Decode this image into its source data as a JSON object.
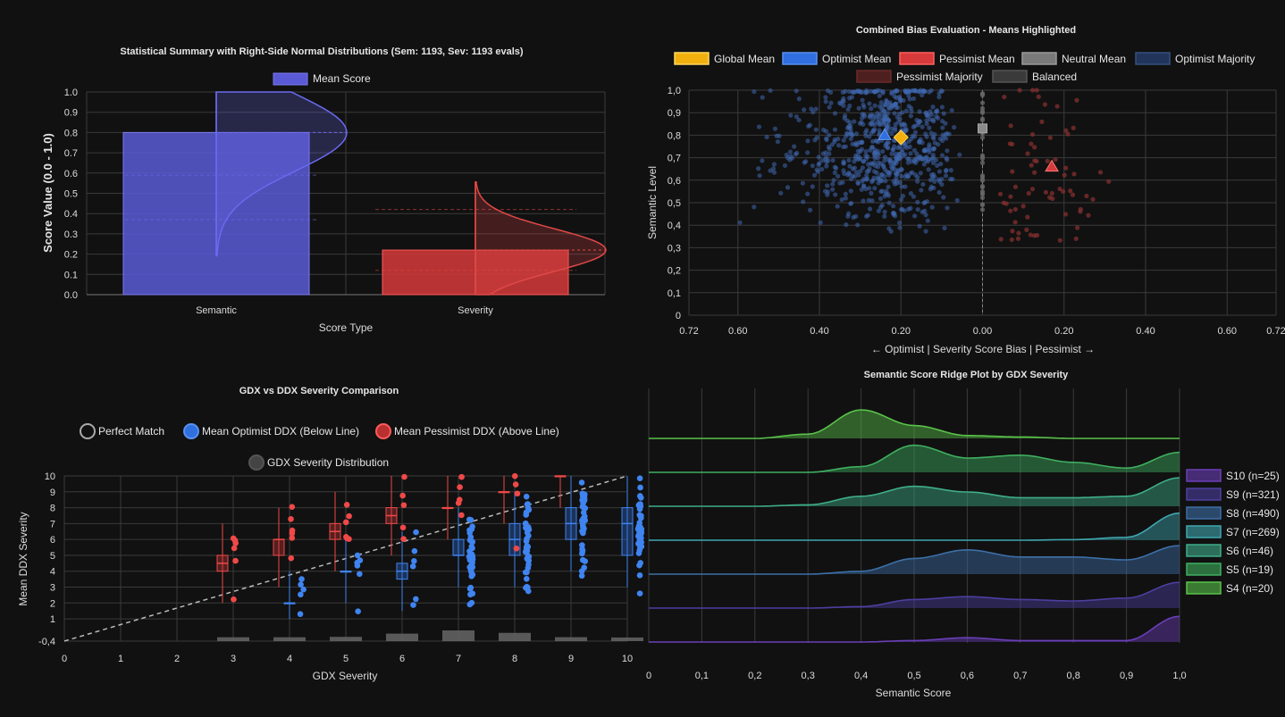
{
  "panel1": {
    "title": "Statistical Summary with Right-Side Normal Distributions (Sem: 1193, Sev: 1193 evals)",
    "legend": "Mean Score",
    "ylabel": "Score Value (0.0 - 1.0)",
    "xlabel": "Score Type",
    "yticks": [
      "0.0",
      "0.1",
      "0.2",
      "0.3",
      "0.4",
      "0.5",
      "0.6",
      "0.7",
      "0.8",
      "0.9",
      "1.0"
    ]
  },
  "panel2": {
    "title": "Combined Bias Evaluation - Means Highlighted",
    "legend": [
      "Global Mean",
      "Optimist Mean",
      "Pessimist Mean",
      "Neutral Mean",
      "Optimist Majority",
      "Pessimist Majority",
      "Balanced"
    ],
    "ylabel": "Semantic Level",
    "xlabel": "← Optimist | Severity Score Bias | Pessimist →",
    "yticks": [
      "0",
      "0,1",
      "0,2",
      "0,3",
      "0,4",
      "0,5",
      "0,6",
      "0,7",
      "0,8",
      "0,9",
      "1,0"
    ],
    "xticks": [
      "0.72",
      "0.60",
      "0.40",
      "0.20",
      "0.00",
      "0.20",
      "0.40",
      "0.60",
      "0.72"
    ]
  },
  "panel3": {
    "title": "GDX vs DDX Severity Comparison",
    "legend": [
      "Perfect Match",
      "Mean Optimist DDX (Below Line)",
      "Mean Pessimist DDX (Above Line)",
      "GDX Severity Distribution"
    ],
    "ylabel": "Mean DDX Severity",
    "xlabel": "GDX Severity",
    "yticks": [
      "-0,4",
      "1",
      "2",
      "3",
      "4",
      "5",
      "6",
      "7",
      "8",
      "9",
      "10"
    ],
    "xticks": [
      "0",
      "1",
      "2",
      "3",
      "4",
      "5",
      "6",
      "7",
      "8",
      "9",
      "10"
    ]
  },
  "panel4": {
    "title": "Semantic Score Ridge Plot by GDX Severity",
    "xlabel": "Semantic Score",
    "xticks": [
      "0",
      "0,1",
      "0,2",
      "0,3",
      "0,4",
      "0,5",
      "0,6",
      "0,7",
      "0,8",
      "0,9",
      "1,0"
    ],
    "legend": [
      "S10 (n=25)",
      "S9 (n=321)",
      "S8 (n=490)",
      "S7 (n=269)",
      "S6 (n=46)",
      "S5 (n=19)",
      "S4 (n=20)"
    ]
  },
  "chart_data": [
    {
      "type": "bar",
      "title": "Statistical Summary with Right-Side Normal Distributions (Sem: 1193, Sev: 1193 evals)",
      "categories": [
        "Semantic",
        "Severity"
      ],
      "series": [
        {
          "name": "Mean Score",
          "values": [
            0.8,
            0.22
          ]
        }
      ],
      "colors": [
        "#5a5ad6",
        "#d63a3a"
      ],
      "xlabel": "Score Type",
      "ylabel": "Score Value (0.0 - 1.0)",
      "ylim": [
        0,
        1.0
      ],
      "grid": true,
      "legend_position": "top"
    },
    {
      "type": "scatter",
      "title": "Combined Bias Evaluation - Means Highlighted",
      "xlabel": "← Optimist | Severity Score Bias | Pessimist →",
      "ylabel": "Semantic Level",
      "xlim": [
        -0.72,
        0.72
      ],
      "ylim": [
        0,
        1.0
      ],
      "means": [
        {
          "name": "Global Mean",
          "x": -0.2,
          "y": 0.79,
          "color": "#f2b00f"
        },
        {
          "name": "Optimist Mean",
          "x": -0.24,
          "y": 0.8,
          "color": "#2f6fe0"
        },
        {
          "name": "Pessimist Mean",
          "x": 0.17,
          "y": 0.66,
          "color": "#d63a3a"
        },
        {
          "name": "Neutral Mean",
          "x": 0.0,
          "y": 0.83,
          "color": "#8a8a8a"
        }
      ],
      "colors": {
        "optimist": "#2d4f86",
        "pessimist": "#6b2a2a",
        "balanced": "#555555"
      },
      "grid": true,
      "legend_position": "top"
    },
    {
      "type": "box",
      "title": "GDX vs DDX Severity Comparison",
      "xlabel": "GDX Severity",
      "ylabel": "Mean DDX Severity",
      "xlim": [
        0,
        10
      ],
      "ylim": [
        -0.4,
        10
      ],
      "optimist": [
        {
          "x": 4,
          "q1": 2,
          "median": 2,
          "q3": 2
        },
        {
          "x": 5,
          "q1": 4,
          "median": 4,
          "q3": 4
        },
        {
          "x": 6,
          "q1": 3.5,
          "median": 4,
          "q3": 4.5
        },
        {
          "x": 7,
          "q1": 5,
          "median": 5,
          "q3": 6
        },
        {
          "x": 8,
          "q1": 5,
          "median": 6,
          "q3": 7
        },
        {
          "x": 9,
          "q1": 6,
          "median": 7,
          "q3": 8
        },
        {
          "x": 10,
          "q1": 5,
          "median": 7,
          "q3": 8
        }
      ],
      "pessimist": [
        {
          "x": 3,
          "q1": 4,
          "median": 4.5,
          "q3": 5
        },
        {
          "x": 4,
          "q1": 5,
          "median": 6,
          "q3": 6
        },
        {
          "x": 5,
          "q1": 6,
          "median": 6.5,
          "q3": 7
        },
        {
          "x": 6,
          "q1": 7,
          "median": 7.5,
          "q3": 8
        },
        {
          "x": 7,
          "q1": 8,
          "median": 8,
          "q3": 8
        },
        {
          "x": 8,
          "q1": 9,
          "median": 9,
          "q3": 9
        },
        {
          "x": 9,
          "q1": 10,
          "median": 10,
          "q3": 10
        }
      ],
      "distribution": [
        {
          "x": 3,
          "count": 20
        },
        {
          "x": 4,
          "count": 19
        },
        {
          "x": 5,
          "count": 46
        },
        {
          "x": 6,
          "count": 269
        },
        {
          "x": 7,
          "count": 490
        },
        {
          "x": 8,
          "count": 321
        },
        {
          "x": 9,
          "count": 25
        },
        {
          "x": 10,
          "count": 3
        }
      ],
      "grid": true
    },
    {
      "type": "area",
      "title": "Semantic Score Ridge Plot by GDX Severity",
      "xlabel": "Semantic Score",
      "xlim": [
        0,
        1.0
      ],
      "x": [
        0,
        0.1,
        0.2,
        0.3,
        0.4,
        0.5,
        0.6,
        0.7,
        0.8,
        0.9,
        1.0
      ],
      "series": [
        {
          "name": "S10 (n=25)",
          "color": "#6a3fb8",
          "values": [
            0,
            0,
            0,
            0,
            0,
            0.05,
            0.15,
            0.05,
            0.05,
            0.05,
            0.9
          ]
        },
        {
          "name": "S9 (n=321)",
          "color": "#4c3fa0",
          "values": [
            0,
            0,
            0,
            0,
            0.05,
            0.3,
            0.4,
            0.3,
            0.25,
            0.35,
            0.9
          ]
        },
        {
          "name": "S8 (n=490)",
          "color": "#3d6fa8",
          "values": [
            0,
            0,
            0,
            0,
            0.1,
            0.55,
            0.85,
            0.6,
            0.6,
            0.5,
            1.0
          ]
        },
        {
          "name": "S7 (n=269)",
          "color": "#3fa7b0",
          "values": [
            0,
            0,
            0,
            0,
            0,
            0,
            0,
            0,
            0.02,
            0.1,
            0.95
          ]
        },
        {
          "name": "S6 (n=46)",
          "color": "#3fae8a",
          "values": [
            0,
            0,
            0,
            0.05,
            0.35,
            0.7,
            0.5,
            0.3,
            0.3,
            0.35,
            1.0
          ]
        },
        {
          "name": "S5 (n=19)",
          "color": "#3fb060",
          "values": [
            0,
            0,
            0,
            0,
            0.2,
            0.95,
            0.5,
            0.6,
            0.35,
            0.15,
            0.7
          ]
        },
        {
          "name": "S4 (n=20)",
          "color": "#59c24a",
          "values": [
            0,
            0,
            0,
            0.15,
            1.0,
            0.45,
            0.1,
            0.05,
            0,
            0,
            0
          ]
        }
      ],
      "grid": true,
      "legend_position": "right"
    }
  ]
}
